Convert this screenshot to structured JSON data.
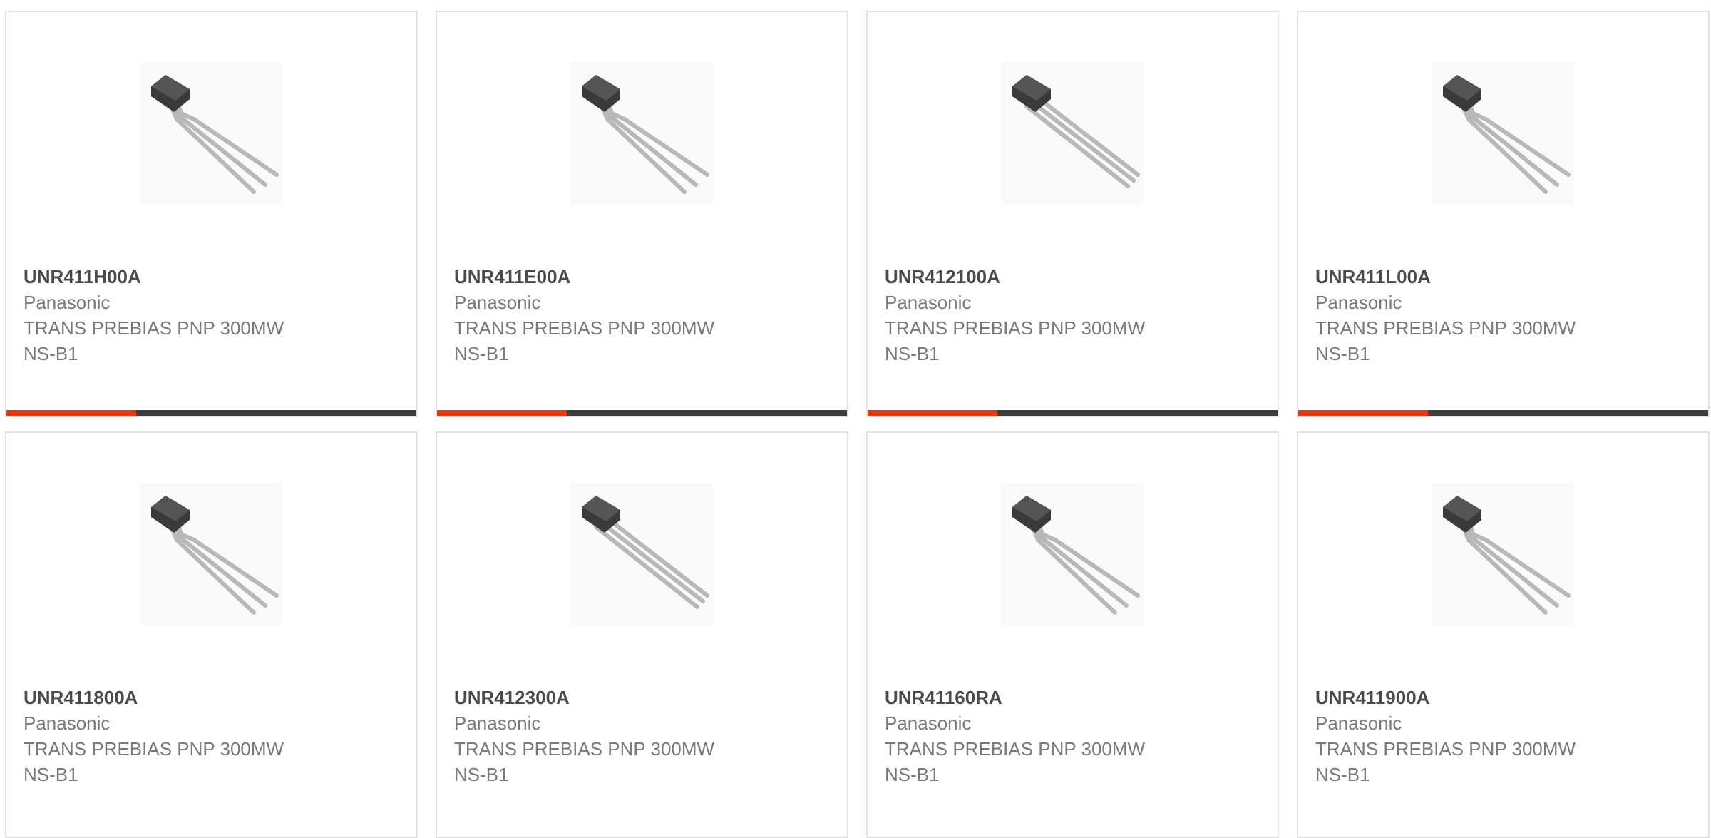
{
  "accent_color": "#e63b10",
  "bar_color": "#3d3d3d",
  "products": [
    {
      "part": "UNR411H00A",
      "manufacturer": "Panasonic",
      "description": "TRANS PREBIAS PNP 300MW",
      "package": "NS-B1",
      "icon": "transistor-to92-image"
    },
    {
      "part": "UNR411E00A",
      "manufacturer": "Panasonic",
      "description": "TRANS PREBIAS PNP 300MW",
      "package": "NS-B1",
      "icon": "transistor-to92-image"
    },
    {
      "part": "UNR412100A",
      "manufacturer": "Panasonic",
      "description": "TRANS PREBIAS PNP 300MW",
      "package": "NS-B1",
      "icon": "transistor-to92-image"
    },
    {
      "part": "UNR411L00A",
      "manufacturer": "Panasonic",
      "description": "TRANS PREBIAS PNP 300MW",
      "package": "NS-B1",
      "icon": "transistor-to92-image"
    },
    {
      "part": "UNR411800A",
      "manufacturer": "Panasonic",
      "description": "TRANS PREBIAS PNP 300MW",
      "package": "NS-B1",
      "icon": "transistor-to92-image"
    },
    {
      "part": "UNR412300A",
      "manufacturer": "Panasonic",
      "description": "TRANS PREBIAS PNP 300MW",
      "package": "NS-B1",
      "icon": "transistor-to92-image"
    },
    {
      "part": "UNR41160RA",
      "manufacturer": "Panasonic",
      "description": "TRANS PREBIAS PNP 300MW",
      "package": "NS-B1",
      "icon": "transistor-to92-image"
    },
    {
      "part": "UNR411900A",
      "manufacturer": "Panasonic",
      "description": "TRANS PREBIAS PNP 300MW",
      "package": "NS-B1",
      "icon": "transistor-to92-image"
    }
  ]
}
